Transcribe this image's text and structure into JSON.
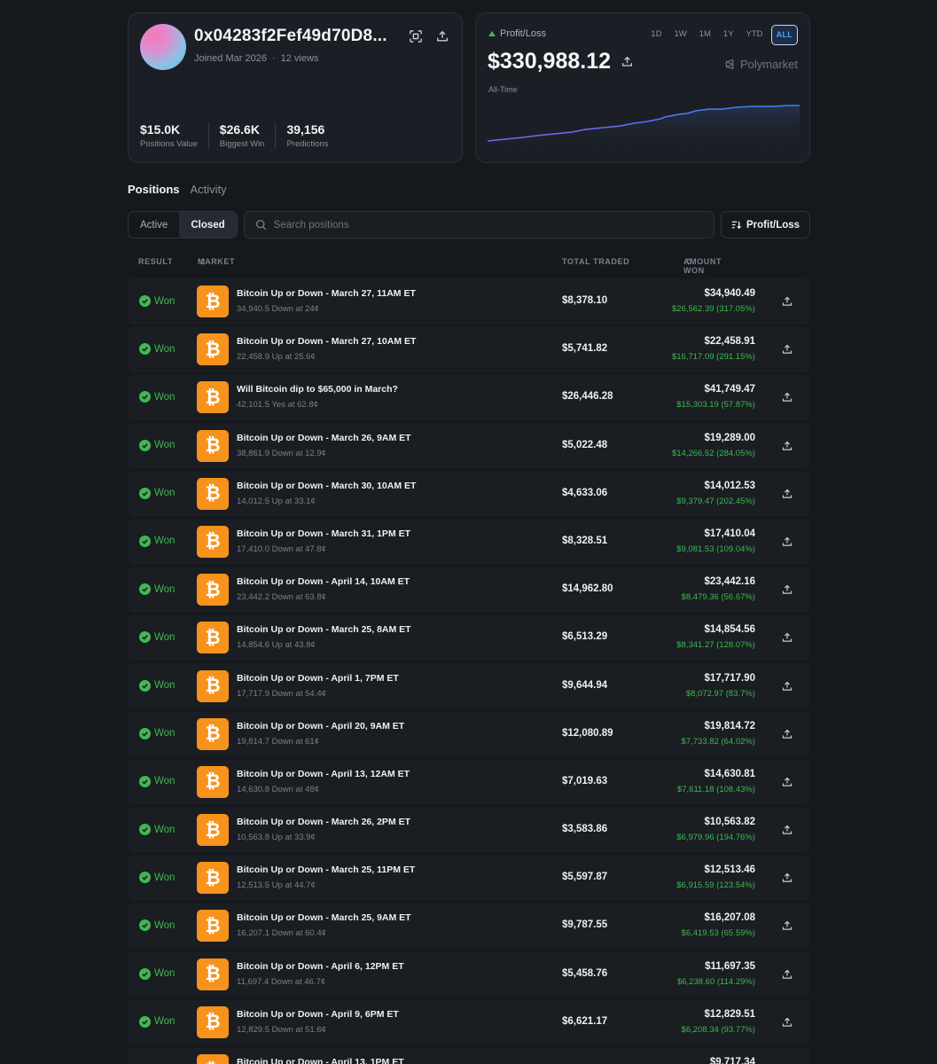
{
  "profile": {
    "username": "0x04283f2Fef49d70D8...",
    "joined": "Joined Mar 2026",
    "views": "12 views",
    "stats": [
      {
        "value": "$15.0K",
        "label": "Positions Value"
      },
      {
        "value": "$26.6K",
        "label": "Biggest Win"
      },
      {
        "value": "39,156",
        "label": "Predictions"
      }
    ]
  },
  "pnl": {
    "label": "Profit/Loss",
    "value": "$330,988.12",
    "period_label": "All-Time",
    "brand": "Polymarket",
    "ranges": [
      "1D",
      "1W",
      "1M",
      "1Y",
      "YTD",
      "ALL"
    ],
    "active_range": "ALL",
    "line_color_start": "#8a5cf6",
    "line_color_end": "#3b82f6"
  },
  "tabs": {
    "positions": "Positions",
    "activity": "Activity"
  },
  "filters": {
    "active": "Active",
    "closed": "Closed",
    "search_placeholder": "Search positions",
    "sort": "Profit/Loss"
  },
  "table": {
    "headers": {
      "result": "RESULT",
      "market": "MARKET",
      "total_traded": "TOTAL TRADED",
      "amount_won": "AMOUNT WON"
    },
    "rows": [
      {
        "result": "Won",
        "title": "Bitcoin Up or Down - March 27, 11AM ET",
        "sub": "34,940.5 Down at 24¢",
        "traded": "$8,378.10",
        "won": "$34,940.49",
        "gain": "$26,562.39 (317.05%)"
      },
      {
        "result": "Won",
        "title": "Bitcoin Up or Down - March 27, 10AM ET",
        "sub": "22,458.9 Up at 25.6¢",
        "traded": "$5,741.82",
        "won": "$22,458.91",
        "gain": "$16,717.09 (291.15%)"
      },
      {
        "result": "Won",
        "title": "Will Bitcoin dip to $65,000 in March?",
        "sub": "42,101.5 Yes at 62.8¢",
        "traded": "$26,446.28",
        "won": "$41,749.47",
        "gain": "$15,303.19 (57.87%)"
      },
      {
        "result": "Won",
        "title": "Bitcoin Up or Down - March 26, 9AM ET",
        "sub": "38,861.9 Down at 12.9¢",
        "traded": "$5,022.48",
        "won": "$19,289.00",
        "gain": "$14,266.52 (284.05%)"
      },
      {
        "result": "Won",
        "title": "Bitcoin Up or Down - March 30, 10AM ET",
        "sub": "14,012.5 Up at 33.1¢",
        "traded": "$4,633.06",
        "won": "$14,012.53",
        "gain": "$9,379.47 (202.45%)"
      },
      {
        "result": "Won",
        "title": "Bitcoin Up or Down - March 31, 1PM ET",
        "sub": "17,410.0 Down at 47.8¢",
        "traded": "$8,328.51",
        "won": "$17,410.04",
        "gain": "$9,081.53 (109.04%)"
      },
      {
        "result": "Won",
        "title": "Bitcoin Up or Down - April 14, 10AM ET",
        "sub": "23,442.2 Down at 63.8¢",
        "traded": "$14,962.80",
        "won": "$23,442.16",
        "gain": "$8,479.36 (56.67%)"
      },
      {
        "result": "Won",
        "title": "Bitcoin Up or Down - March 25, 8AM ET",
        "sub": "14,854.6 Up at 43.8¢",
        "traded": "$6,513.29",
        "won": "$14,854.56",
        "gain": "$8,341.27 (128.07%)"
      },
      {
        "result": "Won",
        "title": "Bitcoin Up or Down - April 1, 7PM ET",
        "sub": "17,717.9 Down at 54.4¢",
        "traded": "$9,644.94",
        "won": "$17,717.90",
        "gain": "$8,072.97 (83.7%)"
      },
      {
        "result": "Won",
        "title": "Bitcoin Up or Down - April 20, 9AM ET",
        "sub": "19,814.7 Down at 61¢",
        "traded": "$12,080.89",
        "won": "$19,814.72",
        "gain": "$7,733.82 (64.02%)"
      },
      {
        "result": "Won",
        "title": "Bitcoin Up or Down - April 13, 12AM ET",
        "sub": "14,630.8 Down at 48¢",
        "traded": "$7,019.63",
        "won": "$14,630.81",
        "gain": "$7,611.18 (108.43%)"
      },
      {
        "result": "Won",
        "title": "Bitcoin Up or Down - March 26, 2PM ET",
        "sub": "10,563.8 Up at 33.9¢",
        "traded": "$3,583.86",
        "won": "$10,563.82",
        "gain": "$6,979.96 (194.76%)"
      },
      {
        "result": "Won",
        "title": "Bitcoin Up or Down - March 25, 11PM ET",
        "sub": "12,513.5 Up at 44.7¢",
        "traded": "$5,597.87",
        "won": "$12,513.46",
        "gain": "$6,915.59 (123.54%)"
      },
      {
        "result": "Won",
        "title": "Bitcoin Up or Down - March 25, 9AM ET",
        "sub": "16,207.1 Down at 60.4¢",
        "traded": "$9,787.55",
        "won": "$16,207.08",
        "gain": "$6,419.53 (65.59%)"
      },
      {
        "result": "Won",
        "title": "Bitcoin Up or Down - April 6, 12PM ET",
        "sub": "11,697.4 Down at 46.7¢",
        "traded": "$5,458.76",
        "won": "$11,697.35",
        "gain": "$6,238.60 (114.29%)"
      },
      {
        "result": "Won",
        "title": "Bitcoin Up or Down - April 9, 6PM ET",
        "sub": "12,829.5 Down at 51.6¢",
        "traded": "$6,621.17",
        "won": "$12,829.51",
        "gain": "$6,208.34 (93.77%)"
      },
      {
        "result": "Won",
        "title": "Bitcoin Up or Down - April 13, 1PM ET",
        "sub": "",
        "traded": "",
        "won": "$9,717.34",
        "gain": ""
      }
    ]
  }
}
